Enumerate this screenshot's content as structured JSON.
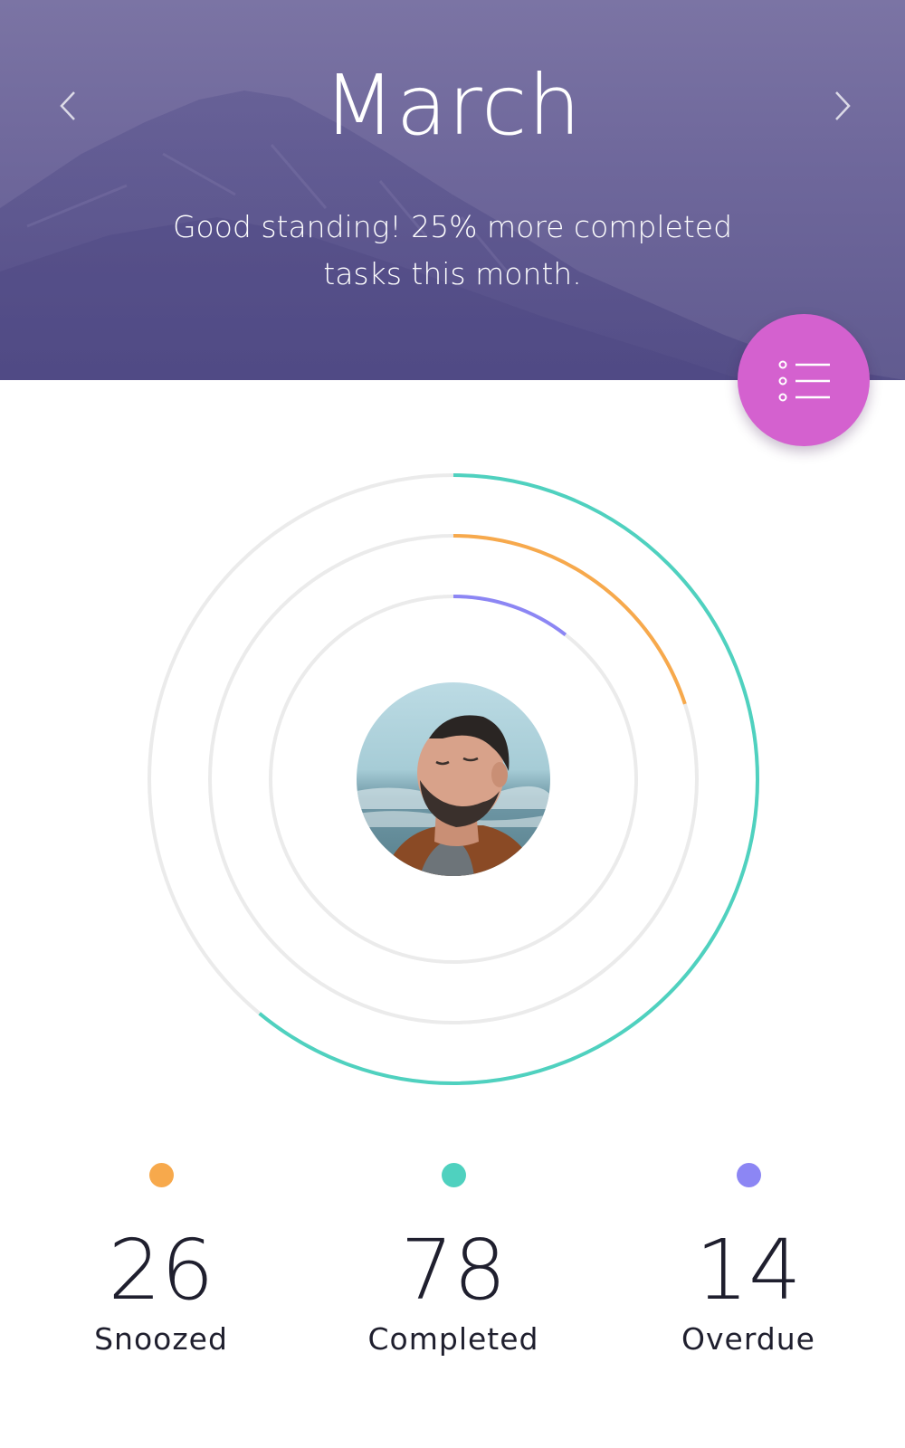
{
  "header": {
    "month": "March",
    "subtitle_line1": "Good standing! 25% more completed",
    "subtitle_line2": "tasks this month.",
    "background_color": "#6e679b",
    "prev_icon": "chevron-left-icon",
    "next_icon": "chevron-right-icon"
  },
  "fab": {
    "icon": "list-icon",
    "color": "#d461cf"
  },
  "rings": [
    {
      "name": "Completed",
      "value": 78,
      "fraction": 0.61,
      "color": "#4fd1bf"
    },
    {
      "name": "Snoozed",
      "value": 26,
      "fraction": 0.2,
      "color": "#f7a94c"
    },
    {
      "name": "Overdue",
      "value": 14,
      "fraction": 0.105,
      "color": "#8c86f4"
    }
  ],
  "track_color": "#ebebeb",
  "stats": {
    "snoozed": {
      "value": "26",
      "label": "Snoozed",
      "color": "#f7a94c"
    },
    "completed": {
      "value": "78",
      "label": "Completed",
      "color": "#4fd1bf"
    },
    "overdue": {
      "value": "14",
      "label": "Overdue",
      "color": "#8c86f4"
    }
  }
}
